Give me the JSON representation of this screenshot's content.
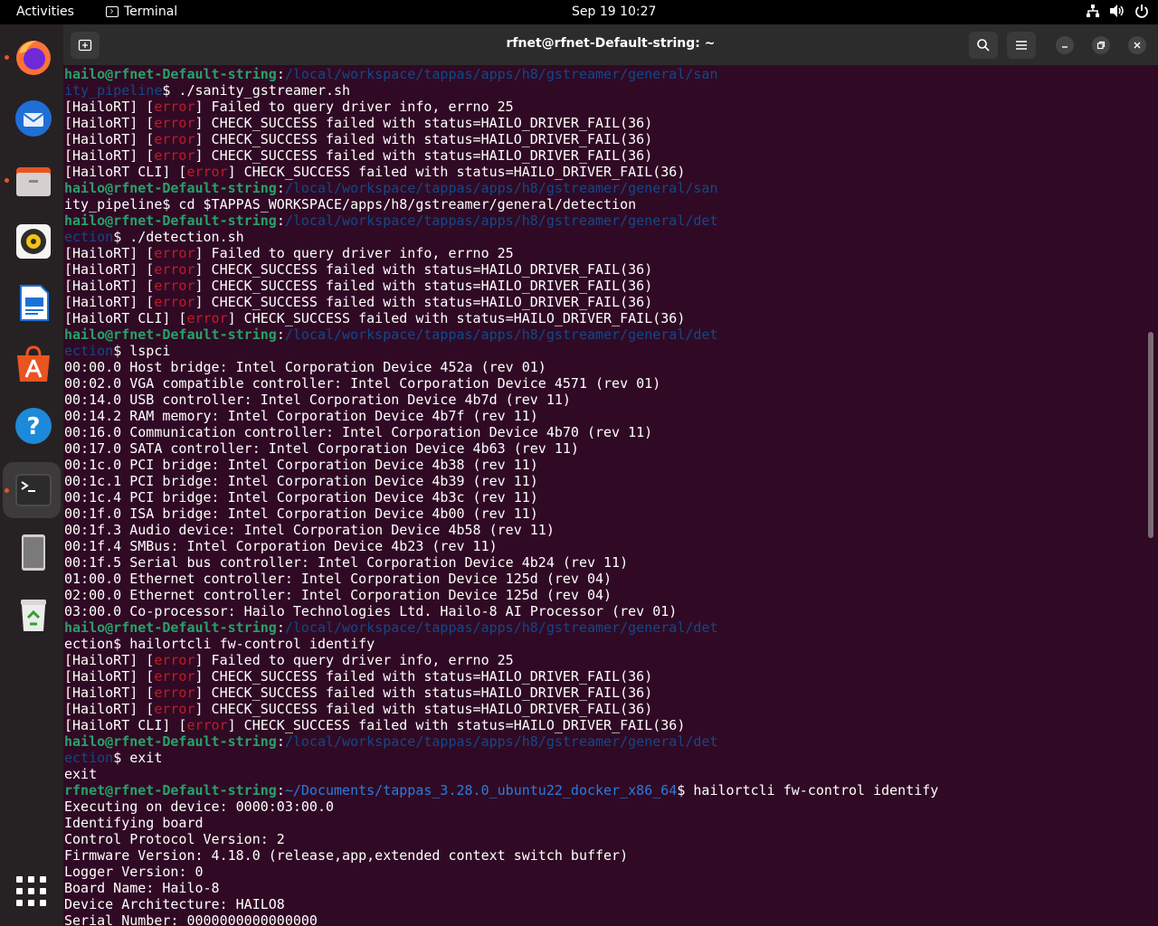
{
  "topbar": {
    "activities": "Activities",
    "app_name": "Terminal",
    "datetime": "Sep 19  10:27",
    "tray_icons": [
      "network-icon",
      "volume-icon",
      "power-icon"
    ]
  },
  "dock": {
    "items": [
      {
        "name": "firefox",
        "running": true
      },
      {
        "name": "thunderbird",
        "running": false
      },
      {
        "name": "files",
        "running": true
      },
      {
        "name": "rhythmbox",
        "running": false
      },
      {
        "name": "libreoffice-writer",
        "running": false
      },
      {
        "name": "app-center",
        "running": false
      },
      {
        "name": "help",
        "running": false
      },
      {
        "name": "terminal",
        "running": true,
        "active": true
      },
      {
        "name": "device",
        "running": false
      },
      {
        "name": "trash",
        "running": false
      }
    ]
  },
  "window": {
    "title": "rfnet@rfnet-Default-string: ~"
  },
  "colors": {
    "user": "#26a269",
    "path": "#12488b",
    "error": "#c01c28",
    "background": "#300a24"
  },
  "terminal": {
    "lines": [
      [
        [
          "u",
          "hailo@rfnet-Default-string"
        ],
        [
          "t",
          ":"
        ],
        [
          "p",
          "/local/workspace/tappas/apps/h8/gstreamer/general/san"
        ]
      ],
      [
        [
          "p",
          "ity_pipeline"
        ],
        [
          "t",
          "$ ./sanity_gstreamer.sh"
        ]
      ],
      [
        [
          "t",
          "[HailoRT] ["
        ],
        [
          "e",
          "error"
        ],
        [
          "t",
          "] Failed to query driver info, errno 25"
        ]
      ],
      [
        [
          "t",
          "[HailoRT] ["
        ],
        [
          "e",
          "error"
        ],
        [
          "t",
          "] CHECK_SUCCESS failed with status=HAILO_DRIVER_FAIL(36)"
        ]
      ],
      [
        [
          "t",
          "[HailoRT] ["
        ],
        [
          "e",
          "error"
        ],
        [
          "t",
          "] CHECK_SUCCESS failed with status=HAILO_DRIVER_FAIL(36)"
        ]
      ],
      [
        [
          "t",
          "[HailoRT] ["
        ],
        [
          "e",
          "error"
        ],
        [
          "t",
          "] CHECK_SUCCESS failed with status=HAILO_DRIVER_FAIL(36)"
        ]
      ],
      [
        [
          "t",
          "[HailoRT CLI] ["
        ],
        [
          "e",
          "error"
        ],
        [
          "t",
          "] CHECK_SUCCESS failed with status=HAILO_DRIVER_FAIL(36)"
        ]
      ],
      [
        [
          "u",
          "hailo@rfnet-Default-string"
        ],
        [
          "t",
          ":"
        ],
        [
          "p",
          "/local/workspace/tappas/apps/h8/gstreamer/general/san"
        ]
      ],
      [
        [
          "t",
          "ity_pipeline$ cd $TAPPAS_WORKSPACE/apps/h8/gstreamer/general/detection"
        ]
      ],
      [
        [
          "u",
          "hailo@rfnet-Default-string"
        ],
        [
          "t",
          ":"
        ],
        [
          "p",
          "/local/workspace/tappas/apps/h8/gstreamer/general/det"
        ]
      ],
      [
        [
          "p",
          "ection"
        ],
        [
          "t",
          "$ ./detection.sh"
        ]
      ],
      [
        [
          "t",
          "[HailoRT] ["
        ],
        [
          "e",
          "error"
        ],
        [
          "t",
          "] Failed to query driver info, errno 25"
        ]
      ],
      [
        [
          "t",
          "[HailoRT] ["
        ],
        [
          "e",
          "error"
        ],
        [
          "t",
          "] CHECK_SUCCESS failed with status=HAILO_DRIVER_FAIL(36)"
        ]
      ],
      [
        [
          "t",
          "[HailoRT] ["
        ],
        [
          "e",
          "error"
        ],
        [
          "t",
          "] CHECK_SUCCESS failed with status=HAILO_DRIVER_FAIL(36)"
        ]
      ],
      [
        [
          "t",
          "[HailoRT] ["
        ],
        [
          "e",
          "error"
        ],
        [
          "t",
          "] CHECK_SUCCESS failed with status=HAILO_DRIVER_FAIL(36)"
        ]
      ],
      [
        [
          "t",
          "[HailoRT CLI] ["
        ],
        [
          "e",
          "error"
        ],
        [
          "t",
          "] CHECK_SUCCESS failed with status=HAILO_DRIVER_FAIL(36)"
        ]
      ],
      [
        [
          "u",
          "hailo@rfnet-Default-string"
        ],
        [
          "t",
          ":"
        ],
        [
          "p",
          "/local/workspace/tappas/apps/h8/gstreamer/general/det"
        ]
      ],
      [
        [
          "p",
          "ection"
        ],
        [
          "t",
          "$ lspci"
        ]
      ],
      [
        [
          "t",
          "00:00.0 Host bridge: Intel Corporation Device 452a (rev 01)"
        ]
      ],
      [
        [
          "t",
          "00:02.0 VGA compatible controller: Intel Corporation Device 4571 (rev 01)"
        ]
      ],
      [
        [
          "t",
          "00:14.0 USB controller: Intel Corporation Device 4b7d (rev 11)"
        ]
      ],
      [
        [
          "t",
          "00:14.2 RAM memory: Intel Corporation Device 4b7f (rev 11)"
        ]
      ],
      [
        [
          "t",
          "00:16.0 Communication controller: Intel Corporation Device 4b70 (rev 11)"
        ]
      ],
      [
        [
          "t",
          "00:17.0 SATA controller: Intel Corporation Device 4b63 (rev 11)"
        ]
      ],
      [
        [
          "t",
          "00:1c.0 PCI bridge: Intel Corporation Device 4b38 (rev 11)"
        ]
      ],
      [
        [
          "t",
          "00:1c.1 PCI bridge: Intel Corporation Device 4b39 (rev 11)"
        ]
      ],
      [
        [
          "t",
          "00:1c.4 PCI bridge: Intel Corporation Device 4b3c (rev 11)"
        ]
      ],
      [
        [
          "t",
          "00:1f.0 ISA bridge: Intel Corporation Device 4b00 (rev 11)"
        ]
      ],
      [
        [
          "t",
          "00:1f.3 Audio device: Intel Corporation Device 4b58 (rev 11)"
        ]
      ],
      [
        [
          "t",
          "00:1f.4 SMBus: Intel Corporation Device 4b23 (rev 11)"
        ]
      ],
      [
        [
          "t",
          "00:1f.5 Serial bus controller: Intel Corporation Device 4b24 (rev 11)"
        ]
      ],
      [
        [
          "t",
          "01:00.0 Ethernet controller: Intel Corporation Device 125d (rev 04)"
        ]
      ],
      [
        [
          "t",
          "02:00.0 Ethernet controller: Intel Corporation Device 125d (rev 04)"
        ]
      ],
      [
        [
          "t",
          "03:00.0 Co-processor: Hailo Technologies Ltd. Hailo-8 AI Processor (rev 01)"
        ]
      ],
      [
        [
          "u",
          "hailo@rfnet-Default-string"
        ],
        [
          "t",
          ":"
        ],
        [
          "p",
          "/local/workspace/tappas/apps/h8/gstreamer/general/det"
        ]
      ],
      [
        [
          "t",
          "ection$ hailortcli fw-control identify"
        ]
      ],
      [
        [
          "t",
          "[HailoRT] ["
        ],
        [
          "e",
          "error"
        ],
        [
          "t",
          "] Failed to query driver info, errno 25"
        ]
      ],
      [
        [
          "t",
          "[HailoRT] ["
        ],
        [
          "e",
          "error"
        ],
        [
          "t",
          "] CHECK_SUCCESS failed with status=HAILO_DRIVER_FAIL(36)"
        ]
      ],
      [
        [
          "t",
          "[HailoRT] ["
        ],
        [
          "e",
          "error"
        ],
        [
          "t",
          "] CHECK_SUCCESS failed with status=HAILO_DRIVER_FAIL(36)"
        ]
      ],
      [
        [
          "t",
          "[HailoRT] ["
        ],
        [
          "e",
          "error"
        ],
        [
          "t",
          "] CHECK_SUCCESS failed with status=HAILO_DRIVER_FAIL(36)"
        ]
      ],
      [
        [
          "t",
          "[HailoRT CLI] ["
        ],
        [
          "e",
          "error"
        ],
        [
          "t",
          "] CHECK_SUCCESS failed with status=HAILO_DRIVER_FAIL(36)"
        ]
      ],
      [
        [
          "u",
          "hailo@rfnet-Default-string"
        ],
        [
          "t",
          ":"
        ],
        [
          "p",
          "/local/workspace/tappas/apps/h8/gstreamer/general/det"
        ]
      ],
      [
        [
          "p",
          "ection"
        ],
        [
          "t",
          "$ exit"
        ]
      ],
      [
        [
          "t",
          "exit"
        ]
      ],
      [
        [
          "u",
          "rfnet@rfnet-Default-string"
        ],
        [
          "t",
          ":"
        ],
        [
          "p2",
          "~/Documents/tappas_3.28.0_ubuntu22_docker_x86_64"
        ],
        [
          "t",
          "$ hailortcli fw-control identify"
        ]
      ],
      [
        [
          "t",
          "Executing on device: 0000:03:00.0"
        ]
      ],
      [
        [
          "t",
          "Identifying board"
        ]
      ],
      [
        [
          "t",
          "Control Protocol Version: 2"
        ]
      ],
      [
        [
          "t",
          "Firmware Version: 4.18.0 (release,app,extended context switch buffer)"
        ]
      ],
      [
        [
          "t",
          "Logger Version: 0"
        ]
      ],
      [
        [
          "t",
          "Board Name: Hailo-8"
        ]
      ],
      [
        [
          "t",
          "Device Architecture: HAILO8"
        ]
      ],
      [
        [
          "t",
          "Serial Number: 0000000000000000"
        ]
      ]
    ]
  }
}
